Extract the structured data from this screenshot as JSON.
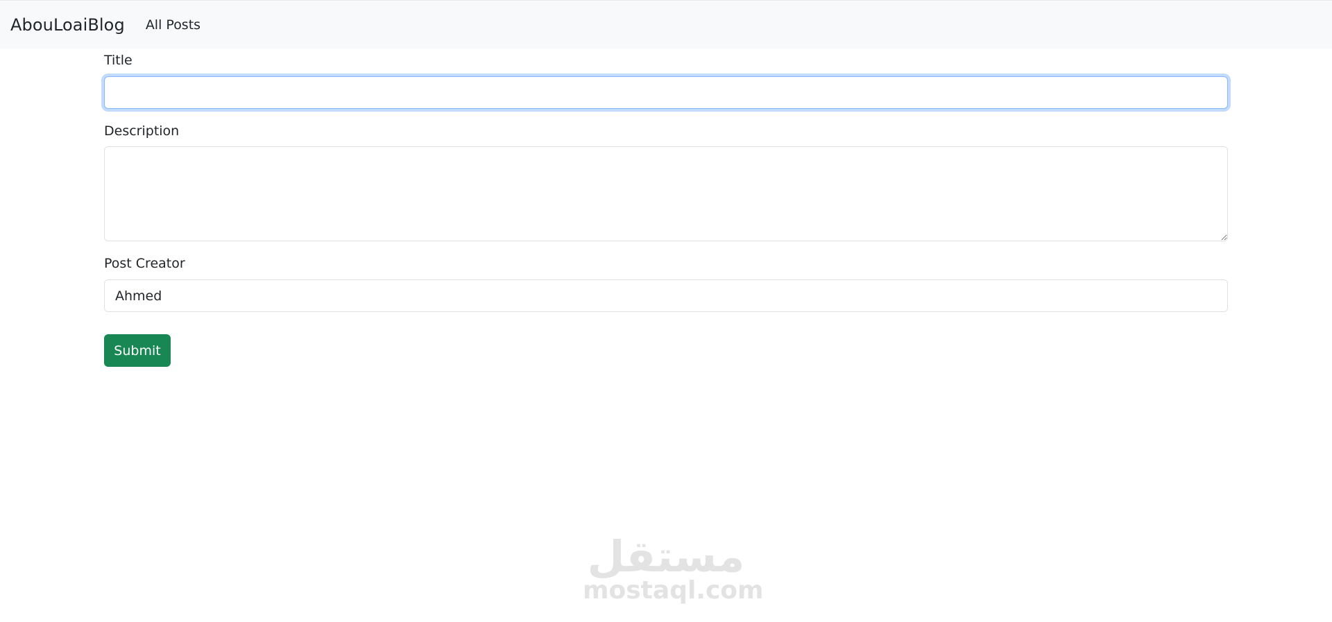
{
  "navbar": {
    "brand": "AbouLoaiBlog",
    "links": [
      "All Posts"
    ]
  },
  "form": {
    "title_label": "Title",
    "title_value": "",
    "description_label": "Description",
    "description_value": "",
    "creator_label": "Post Creator",
    "creator_value": "Ahmed",
    "submit_label": "Submit"
  },
  "watermark": {
    "arabic": "مستقل",
    "latin": "mostaql.com"
  },
  "colors": {
    "navbar_bg": "#f8f9fa",
    "submit_bg": "#198754",
    "focus_ring": "#86b7fe"
  }
}
